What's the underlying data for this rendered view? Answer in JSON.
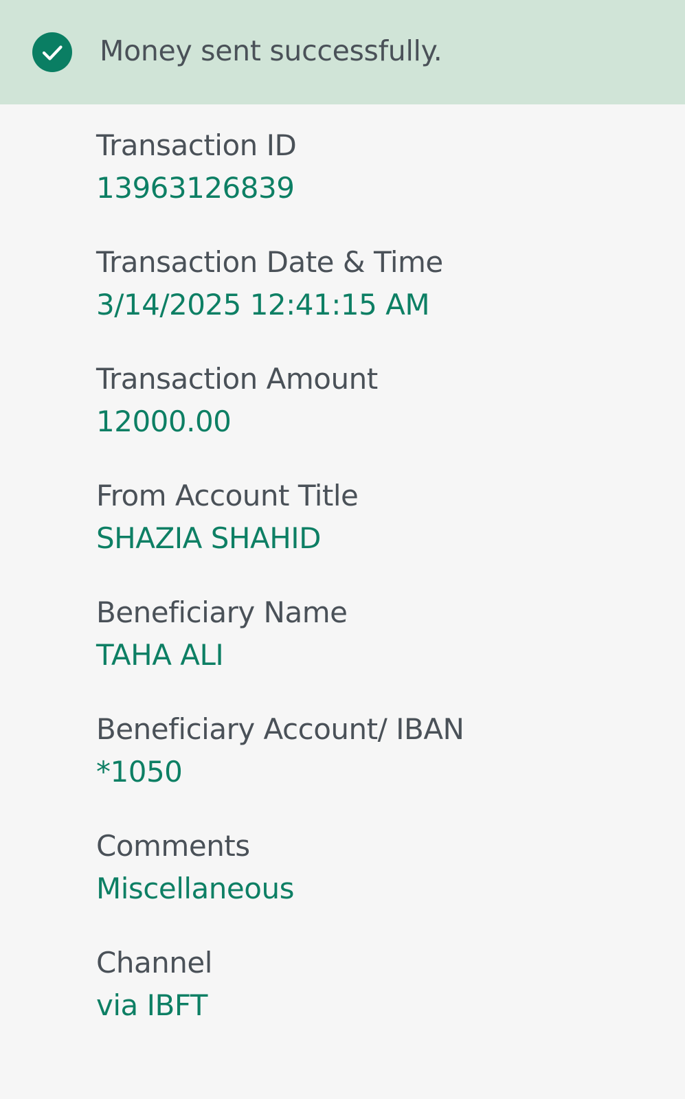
{
  "banner": {
    "icon": "check-circle-icon",
    "message": "Money sent successfully.",
    "background_color": "#d0e4d7",
    "icon_color": "#0a7e63"
  },
  "colors": {
    "label": "#4a5158",
    "value": "#0d7f64",
    "page_background": "#f6f6f6"
  },
  "details": {
    "fields": [
      {
        "label": "Transaction ID",
        "value": "13963126839"
      },
      {
        "label": "Transaction Date & Time",
        "value": "3/14/2025 12:41:15 AM"
      },
      {
        "label": "Transaction Amount",
        "value": "12000.00"
      },
      {
        "label": "From Account Title",
        "value": "SHAZIA SHAHID"
      },
      {
        "label": "Beneficiary Name",
        "value": "TAHA ALI"
      },
      {
        "label": "Beneficiary Account/ IBAN",
        "value": "*1050"
      },
      {
        "label": "Comments",
        "value": "Miscellaneous"
      },
      {
        "label": "Channel",
        "value": "via IBFT"
      }
    ]
  }
}
